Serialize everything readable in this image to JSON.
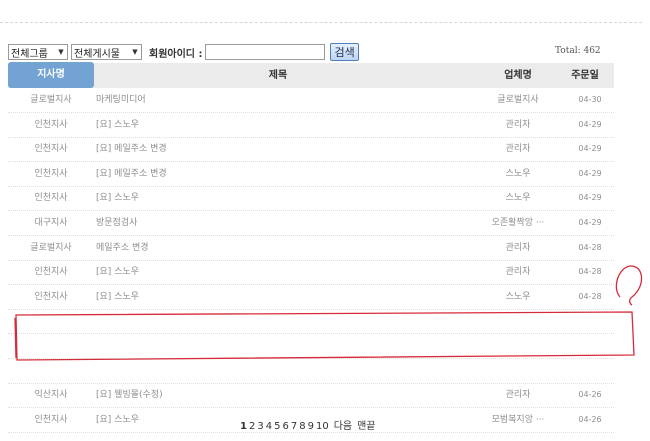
{
  "filters": {
    "group_select": "전체그룹",
    "board_select": "전체게시물",
    "member_id_label": "회원아이디 :",
    "member_id_value": "",
    "search_label": "검색"
  },
  "total": "Total: 462",
  "table": {
    "headers": {
      "branch": "지사명",
      "title": "제목",
      "company": "업체명",
      "date": "주문일"
    },
    "rows": [
      {
        "branch": "글로벌지사",
        "title": "마케팅미디어",
        "company": "글로벌지사",
        "date": "04-30"
      },
      {
        "branch": "인천지사",
        "title": "[요] 스노우",
        "company": "관리자",
        "date": "04-29"
      },
      {
        "branch": "인천지사",
        "title": "[요] 메일주소 변경",
        "company": "관리자",
        "date": "04-29"
      },
      {
        "branch": "인천지사",
        "title": "[요] 메일주소 변경",
        "company": "스노우",
        "date": "04-29"
      },
      {
        "branch": "인천지사",
        "title": "[요] 스노우",
        "company": "스노우",
        "date": "04-29"
      },
      {
        "branch": "대구지사",
        "title": "방문점검사",
        "company": "오존활짝앙 ···",
        "date": "04-29"
      },
      {
        "branch": "글로벌지사",
        "title": "메일주소 변경",
        "company": "관리자",
        "date": "04-28"
      },
      {
        "branch": "인천지사",
        "title": "[요] 스노우",
        "company": "관리자",
        "date": "04-28"
      },
      {
        "branch": "인천지사",
        "title": "[요] 스노우",
        "company": "스노우",
        "date": "04-28"
      },
      {
        "branch": "",
        "title": "",
        "company": "",
        "date": ""
      },
      {
        "branch": "",
        "title": "",
        "company": "",
        "date": ""
      },
      {
        "branch": "",
        "title": "",
        "company": "",
        "date": ""
      },
      {
        "branch": "익산지사",
        "title": "[요] 웰빙몰(수정)",
        "company": "관리자",
        "date": "04-26"
      },
      {
        "branch": "인천지사",
        "title": "[요] 스노우",
        "company": "모범복지앙 ···",
        "date": "04-26"
      }
    ]
  },
  "pagination": {
    "pages": [
      "1",
      "2",
      "3",
      "4",
      "5",
      "6",
      "7",
      "8",
      "9",
      "10"
    ],
    "current": "1",
    "next_label": "다음",
    "last_label": "맨끝"
  },
  "annotation_color": "#d62b3a"
}
